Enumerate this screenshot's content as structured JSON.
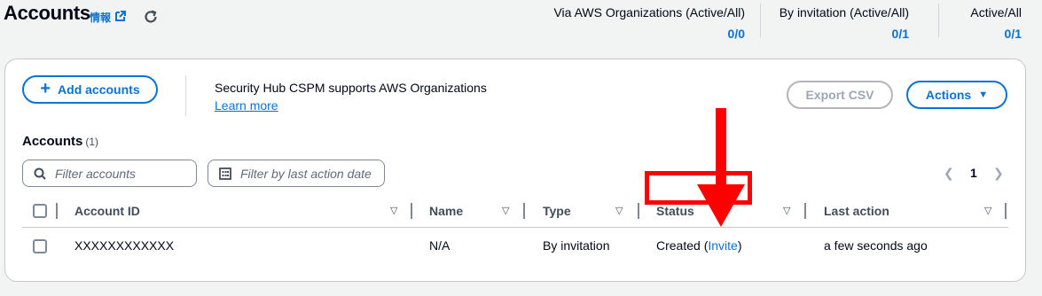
{
  "header": {
    "title": "Accounts",
    "info_label": "情報",
    "stats": [
      {
        "label": "Via AWS Organizations (Active/All)",
        "value": "0/0"
      },
      {
        "label": "By invitation (Active/All)",
        "value": "0/1"
      },
      {
        "label": "Active/All",
        "value": "0/1"
      }
    ]
  },
  "toolbar": {
    "add_accounts_label": "Add accounts",
    "org_support_text": "Security Hub CSPM supports AWS Organizations",
    "learn_more_label": "Learn more",
    "export_csv_label": "Export CSV",
    "actions_label": "Actions"
  },
  "table": {
    "title": "Accounts",
    "count": "(1)",
    "filter_accounts_placeholder": "Filter accounts",
    "filter_date_placeholder": "Filter by last action date",
    "page_number": "1",
    "columns": [
      "Account ID",
      "Name",
      "Type",
      "Status",
      "Last action"
    ],
    "rows": [
      {
        "account_id": "XXXXXXXXXXXX",
        "name": "N/A",
        "type": "By invitation",
        "status_text": "Created",
        "status_open": " (",
        "status_link": "Invite",
        "status_close": ")",
        "last_action": "a few seconds ago"
      }
    ]
  },
  "colors": {
    "link": "#0972d3",
    "annotation": "#ff0000"
  }
}
